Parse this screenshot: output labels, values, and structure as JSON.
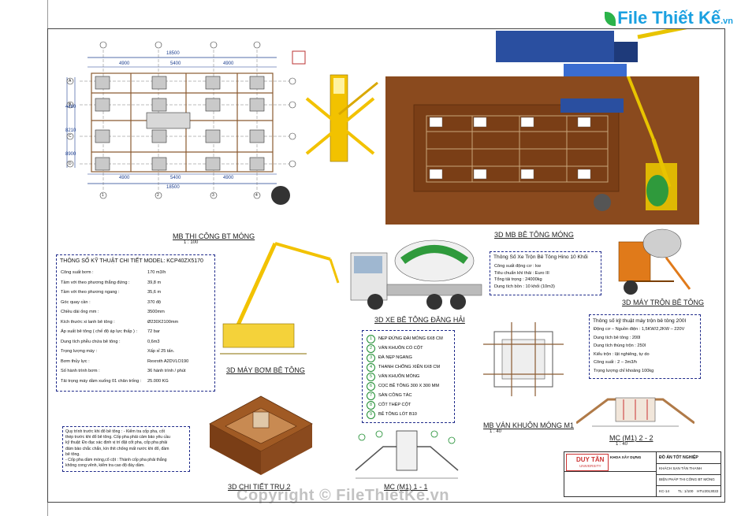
{
  "logo": {
    "brand": "File Thiết Kế",
    "suffix": ".vn"
  },
  "watermark": "Copyright © FileThietKe.vn",
  "drawings": {
    "plan": {
      "title": "MB THI CÔNG BT MÓNG",
      "scale": "1 : 100",
      "dims": [
        "18500",
        "4900",
        "5400",
        "4900",
        "18500",
        "4900",
        "5400",
        "4900",
        "4460",
        "8210",
        "8900"
      ],
      "axes_letters": [
        "A",
        "B",
        "C",
        "D"
      ],
      "axes_numbers": [
        "1",
        "2",
        "3",
        "4"
      ]
    },
    "plan3d": {
      "title": "3D MB BÊ TÔNG MÓNG"
    },
    "pump3d": {
      "title": "3D MÁY BƠM BÊ TÔNG"
    },
    "truck3d": {
      "title": "3D XE BÊ TÔNG ĐĂNG HẢI"
    },
    "mixer3d": {
      "title": "3D MÁY TRỘN BÊ TÔNG"
    },
    "formwork_plan": {
      "title": "MB VÁN KHUÔN MÓNG M1",
      "scale": "1 : 40"
    },
    "section": {
      "title": "MC (M1) 2 - 2",
      "scale": "1 : 40"
    },
    "column3d": {
      "title": "3D CHI TIẾT TRỤ 2"
    },
    "detail": {
      "title": "MC (M1) 1 - 1"
    }
  },
  "pump_spec": {
    "heading": "THÔNG SỐ KỸ THUẬT CHI TIẾT MODEL: KCP40ZX5170",
    "rows": [
      [
        "Công suất bơm :",
        "170 m3/h"
      ],
      [
        "Tầm với theo phương thẳng đứng :",
        "39,8 m"
      ],
      [
        "Tầm với theo phương ngang :",
        "35,6 m"
      ],
      [
        "Góc quay cần :",
        "370 độ"
      ],
      [
        "Chiều dài ống mm :",
        "3500mm"
      ],
      [
        "Kích thước xi lanh bê tông :",
        "Ø230X2100mm"
      ],
      [
        "Áp suất bê tông ( chế độ áp lực thấp ) :",
        "72 bar"
      ],
      [
        "Dung tích phễu chứa bê tông :",
        "0,6m3"
      ],
      [
        "Trọng lượng máy :",
        "Xấp xỉ 25 tấn."
      ],
      [
        "Bơm thủy lực :",
        "Rexroth A2DVLO190"
      ],
      [
        "Số hành trình bơm :",
        "36 hành trình / phút"
      ],
      [
        "Tải trọng máy dầm xuống 01 chân trống :",
        "25.000 KG"
      ]
    ]
  },
  "truck_spec": {
    "heading": "Thông Số Xe Trộn Bê Tông Hino 10 Khối",
    "rows": [
      "Công suất động cơ : kw",
      "Tiêu chuẩn khí thải : Euro III",
      "Tổng tải trọng : 24000kg",
      "Dung tích bồn : 10 khối (10m3)"
    ]
  },
  "mixer_spec": {
    "heading": "Thông số kỹ thuật máy trộn bê tông 200l",
    "rows": [
      "Động cơ – Nguồn điện : 1,5KW/2,2KW – 220V",
      "Dung tích bê tông : 200l",
      "Dung tích thùng trộn : 250l",
      "Kiểu trộn : lật nghiêng, tự do",
      "Công suất : 2 – 3m3/h",
      "Trọng lượng chỉ khoảng 100kg"
    ]
  },
  "legend": [
    "NẸP ĐỨNG ĐÀI MÓNG 6X8 CM",
    "VÁN KHUÔN CỔ CỘT",
    "ĐÀ NẸP NGANG",
    "THANH CHỐNG XIÊN 6X8 CM",
    "VÁN KHUÔN MÓNG",
    "CỌC BÊ TÔNG 300 X 300 MM",
    "SÀN CÔNG TÁC",
    "CỐT THÉP CỘT",
    "BÊ TÔNG LÓT B10"
  ],
  "notes": {
    "lines": [
      "Quy trình trước khi đổ bê tông : - Kiểm tra cốp pha, cốt",
      "thép trước khi đổ bê tông. Cốp pha phải cảm bảo yêu cầu",
      "kỹ thuật: Đo đạc xác định vị trí đặt cốt pha, cốp pha phải",
      "đảm bảo chắc chắn, kín thít chống mất nước khi đổ, đầm",
      "bê tông.",
      "- Cốp pha dầm móng,cổ cột : Thành cốp pha phải thẳng",
      "không cong vênh, kiểm tra cao độ đáy dầm."
    ]
  },
  "title_block": {
    "school": "DUY TÂN",
    "school_sub": "UNIVERSITY",
    "faculty": "KHOA XÂY DỰNG",
    "project_type": "ĐỒ ÁN TỐT NGHIỆP",
    "project": "KHÁCH SẠN TÂN THANH",
    "sheet_name": "BIỆN PHÁP THI CÔNG BT MÓNG",
    "sheet_no": "KC-14",
    "scale": "TL: 1/100",
    "code": "HTU2013022"
  },
  "colors": {
    "soil": "#8a4a1e",
    "crane_yellow": "#f2c200",
    "truck_green": "#2f9a3c",
    "formwork": "#b07a48",
    "dim_blue": "#1d3f8f",
    "spec_border": "#1f2a8a",
    "legend_green": "#1b8c2e",
    "orange": "#e07a1a"
  }
}
